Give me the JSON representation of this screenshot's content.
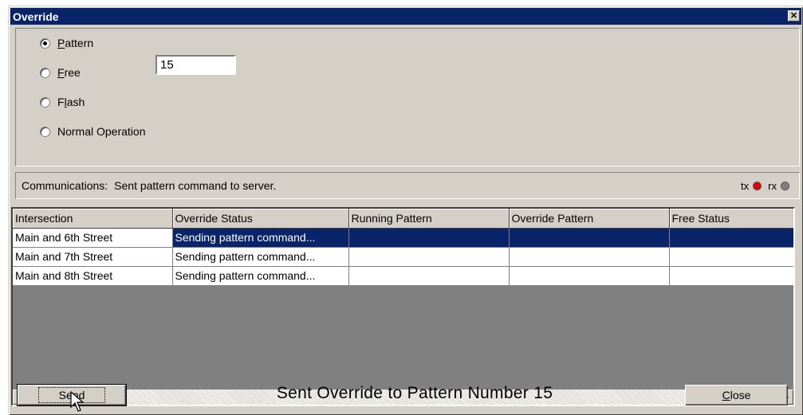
{
  "window": {
    "title": "Override",
    "close_glyph": "✕"
  },
  "options": {
    "pattern": {
      "label_ul": "P",
      "label_rest": "attern",
      "selected": true,
      "value": "15"
    },
    "free": {
      "label_ul": "F",
      "label_rest": "ree",
      "selected": false
    },
    "flash": {
      "label_pre": "F",
      "label_ul": "l",
      "label_rest": "ash",
      "selected": false
    },
    "normal": {
      "label": "Normal Operation",
      "selected": false
    }
  },
  "communications": {
    "label": "Communications:",
    "message": "Sent pattern command to server.",
    "tx_label": "tx",
    "rx_label": "rx",
    "tx_color": "#e00000",
    "rx_color": "#808080"
  },
  "grid": {
    "columns": [
      "Intersection",
      "Override Status",
      "Running Pattern",
      "Override Pattern",
      "Free Status"
    ],
    "rows": [
      [
        "Main and 6th Street",
        "Sending pattern command...",
        "",
        "",
        ""
      ],
      [
        "Main and 7th Street",
        "Sending pattern command...",
        "",
        "",
        ""
      ],
      [
        "Main and 8th Street",
        "Sending pattern command...",
        "",
        "",
        ""
      ]
    ],
    "selected_row": 0
  },
  "footer": {
    "send_pre": "Se",
    "send_ul": "n",
    "send_rest": "d",
    "status_message": "Sent Override to Pattern Number 15",
    "close_ul": "C",
    "close_rest": "lose"
  },
  "colors": {
    "titlebar": "#0a246a",
    "face": "#d4d0c8",
    "selection": "#0a246a"
  }
}
